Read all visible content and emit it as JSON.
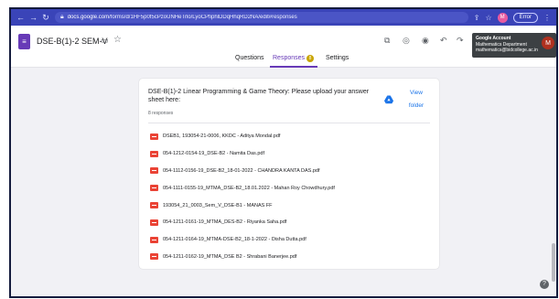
{
  "browser": {
    "url_host": "docs.google.com",
    "url_path": "/forms/d/1HF5p0f5cPzoUNHeTrlo/LyoCPfiphlDDqHhqRD2NA/edit#responses",
    "error_label": "Error"
  },
  "header": {
    "title": "DSE-B(1)-2 SEM-V",
    "tabs": [
      {
        "label": "Questions"
      },
      {
        "label": "Responses",
        "badge": "8"
      },
      {
        "label": "Settings"
      }
    ]
  },
  "account_tooltip": {
    "title": "Google Account",
    "name": "Mathematics Department",
    "email": "mathematics@bidcollege.ac.in"
  },
  "avatar_letter": "M",
  "question": {
    "title": "DSE-B(1)-2 Linear Programming & Game Theory: Please upload your answer sheet here:",
    "response_count": "8 responses",
    "view_folder_label": "View folder"
  },
  "files": [
    "DSEB1, 193054-21-0006, KKDC - Aditya Mondal.pdf",
    "054-1212-0154-19_DSE-B2 - Namita Das.pdf",
    "054-1112-0156-19_DSE-B2_18-01-2022 - CHANDRA KANTA DAS.pdf",
    "054-1111-0155-19_MTMA_DSE-B2_18.01.2022 - Mahan Roy Chowdhury.pdf",
    "193054_21_0003_Sem_V_DSE-B1 - MANAS FF",
    "054-1211-0161-19_MTMA_DES-B2 - Riyanka Saha.pdf",
    "054-1211-0164-19_MTMA-DSE-B2_18-1-2022 - Disha Dutta.pdf",
    "054-1211-0162-19_MTMA_DSE B2 - Shrabani Banerjee.pdf"
  ],
  "colors": {
    "brand_purple": "#673ab7",
    "pdf_red": "#ea4335",
    "link_blue": "#1a73e8",
    "chrome_blue": "#3a44b8"
  }
}
